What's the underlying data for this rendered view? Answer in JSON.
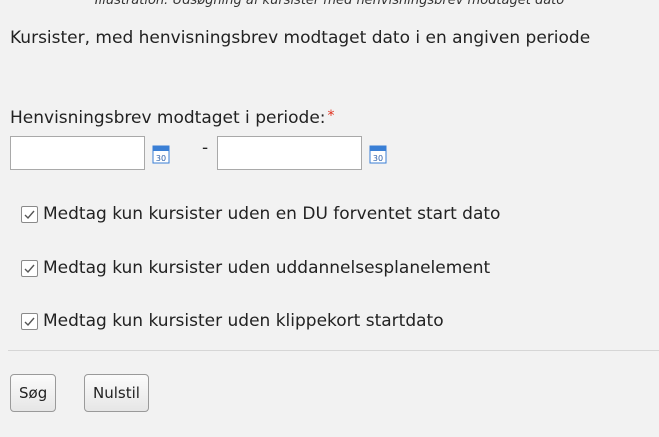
{
  "caption": "Illustration: Udsøgning af kursister med henvisningsbrev modtaget dato",
  "form": {
    "title": "Kursister, med henvisningsbrev modtaget dato i en angiven periode",
    "period_label": "Henvisningsbrev modtaget i periode:",
    "required_mark": "*",
    "date_from_value": "",
    "date_to_value": "",
    "calendar_icon_text": "30",
    "range_separator": "-",
    "checkboxes": [
      {
        "label": "Medtag kun kursister uden en DU forventet start dato",
        "checked": true
      },
      {
        "label": "Medtag kun kursister uden uddannelsesplanelement",
        "checked": true
      },
      {
        "label": "Medtag kun kursister uden klippekort startdato",
        "checked": true
      }
    ],
    "buttons": {
      "search_label": "Søg",
      "reset_label": "Nulstil"
    }
  },
  "colors": {
    "required": "#e0301e",
    "calendar_blue": "#3a7fd5",
    "background": "#f2f2f2"
  },
  "icons": {
    "calendar": "calendar-icon",
    "checkmark": "checkmark-icon"
  }
}
